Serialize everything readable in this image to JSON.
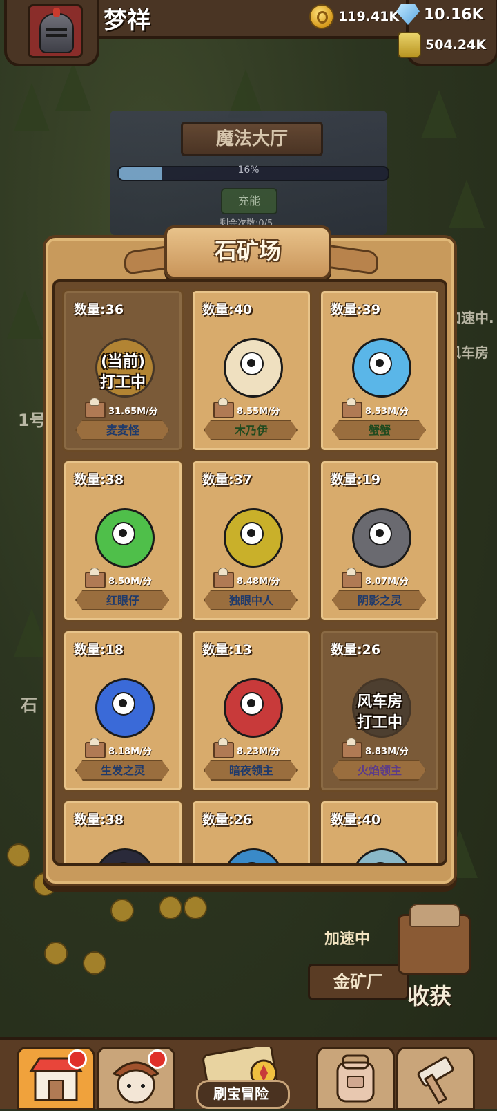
{
  "header": {
    "player_name": "梦祥",
    "resources": {
      "coins": "119.41K",
      "gems": "10.16K",
      "ore": "504.24K"
    }
  },
  "background": {
    "hall_sign": "魔法大厅",
    "hall_progress_label": "16%",
    "hall_progress_value": 0.16,
    "hall_charge_button": "充能",
    "hall_count": "剩余次数:0/5",
    "speed_label": "加速中",
    "mine_sign": "金矿厂",
    "harvest_label": "收获",
    "side_labels": [
      "1号",
      "石",
      "加速中.",
      "风车房"
    ]
  },
  "panel": {
    "title": "石矿场",
    "cards": [
      {
        "qty": "数量:36",
        "rate": "31.65M/分",
        "name": "麦麦怪",
        "status": "(当前)\n打工中",
        "dark": true,
        "color": "#e0a830"
      },
      {
        "qty": "数量:40",
        "rate": "8.55M/分",
        "name": "木乃伊",
        "status": "",
        "dark": false,
        "color": "#efe0c0"
      },
      {
        "qty": "数量:39",
        "rate": "8.53M/分",
        "name": "蟹蟹",
        "status": "",
        "dark": false,
        "color": "#5ab6e8"
      },
      {
        "qty": "数量:38",
        "rate": "8.50M/分",
        "name": "红眼仔",
        "status": "",
        "dark": false,
        "color": "#4fbf4a"
      },
      {
        "qty": "数量:37",
        "rate": "8.48M/分",
        "name": "独眼中人",
        "status": "",
        "dark": false,
        "color": "#c9b02a"
      },
      {
        "qty": "数量:19",
        "rate": "8.07M/分",
        "name": "阴影之灵",
        "status": "",
        "dark": false,
        "color": "#6a6a70"
      },
      {
        "qty": "数量:18",
        "rate": "8.18M/分",
        "name": "生发之灵",
        "status": "",
        "dark": false,
        "color": "#3a6ad8"
      },
      {
        "qty": "数量:13",
        "rate": "8.23M/分",
        "name": "暗夜领主",
        "status": "",
        "dark": false,
        "color": "#c83a3a"
      },
      {
        "qty": "数量:26",
        "rate": "8.83M/分",
        "name": "火焰领主",
        "status": "风车房\n打工中",
        "dark": true,
        "color": "#2a2a2a"
      },
      {
        "qty": "数量:38",
        "rate": "",
        "name": "",
        "status": "",
        "dark": false,
        "color": "#2a2a3a"
      },
      {
        "qty": "数量:26",
        "rate": "",
        "name": "",
        "status": "",
        "dark": false,
        "color": "#3a8ac8"
      },
      {
        "qty": "数量:40",
        "rate": "",
        "name": "",
        "status": "",
        "dark": false,
        "color": "#8ab8c8"
      }
    ]
  },
  "bottom_nav": {
    "treasure_label": "刷宝冒险",
    "items": [
      {
        "icon": "shop-icon",
        "badge": true
      },
      {
        "icon": "hero-icon",
        "badge": true
      },
      {
        "icon": "treasure-map-icon",
        "badge": false
      },
      {
        "icon": "backpack-icon",
        "badge": false
      },
      {
        "icon": "forge-icon",
        "badge": false
      }
    ]
  }
}
